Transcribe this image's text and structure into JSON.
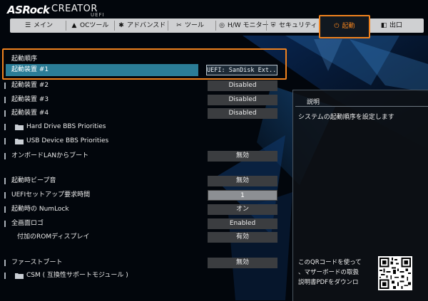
{
  "brand": {
    "logo": "ASRock",
    "product": "CREATOR",
    "sub": "UEFI"
  },
  "tabs": [
    {
      "label": "メイン",
      "icon": "list-icon",
      "glyph": "☰"
    },
    {
      "label": "OCツール",
      "icon": "flame-icon",
      "glyph": "🔥"
    },
    {
      "label": "アドバンスド",
      "icon": "star-icon",
      "glyph": "✱"
    },
    {
      "label": "ツール",
      "icon": "wrench-icon",
      "glyph": "✂"
    },
    {
      "label": "H/W モニター",
      "icon": "gauge-icon",
      "glyph": "◎"
    },
    {
      "label": "セキュリティ",
      "icon": "shield-icon",
      "glyph": "⛨"
    },
    {
      "label": "起動",
      "icon": "power-icon",
      "glyph": "⏻",
      "active": true
    },
    {
      "label": "出口",
      "icon": "exit-icon",
      "glyph": "◧"
    }
  ],
  "section": {
    "title": "起動順序"
  },
  "selected": {
    "label": "起動装置 #1",
    "value": "UEFI: SanDisk Ext..."
  },
  "rows": [
    {
      "label": "起動装置 #2",
      "value": "Disabled"
    },
    {
      "label": "起動装置 #3",
      "value": "Disabled"
    },
    {
      "label": "起動装置 #4",
      "value": "Disabled"
    },
    {
      "label": "Hard Drive BBS Priorities",
      "folder": true
    },
    {
      "label": "USB Device BBS Priorities",
      "folder": true
    },
    {
      "label": "オンボードLANからブート",
      "value": "無効"
    },
    {
      "label": "起動時ビープ音",
      "value": "無効"
    },
    {
      "label": "UEFIセットアップ要求時間",
      "value": "1",
      "light": true
    },
    {
      "label": "起動時の NumLock",
      "value": "オン"
    },
    {
      "label": "全画面ロゴ",
      "value": "Enabled"
    },
    {
      "label": "付加のROMディスプレイ",
      "value": "有効"
    },
    {
      "label": "ファーストブート",
      "value": "無効"
    },
    {
      "label": "CSM ( 互換性サポートモジュール )",
      "folder": true
    }
  ],
  "panel": {
    "title": "説明",
    "description": "システムの起動順序を設定します",
    "qr_line1": "このQRコードを使って",
    "qr_line2": "、マザーボードの取扱",
    "qr_line3": "説明書PDFをダウンロ"
  },
  "colors": {
    "accent": "#f0821e",
    "selection": "#2b7d97",
    "background": "#02060c"
  }
}
